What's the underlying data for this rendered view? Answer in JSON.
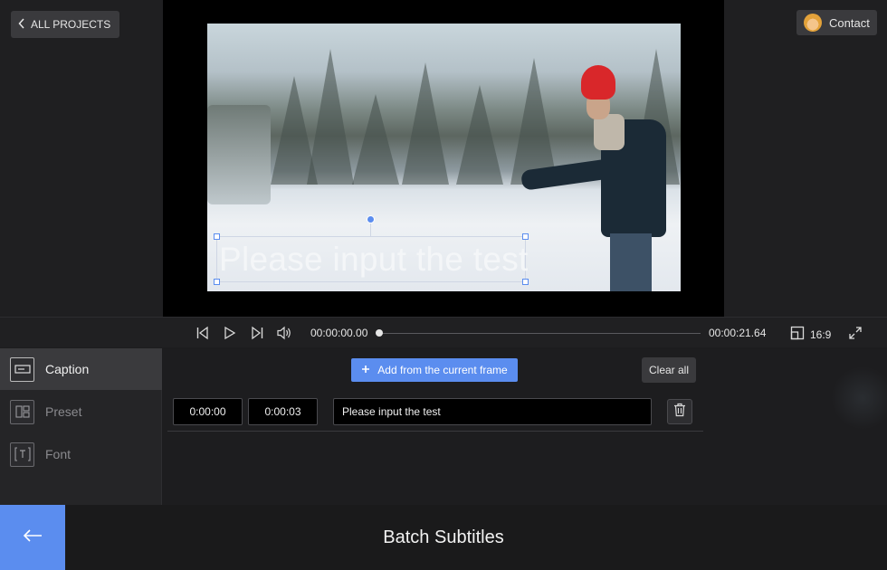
{
  "header": {
    "all_projects_label": "ALL PROJECTS",
    "contact_label": "Contact"
  },
  "preview": {
    "caption_text": "Please input the test"
  },
  "transport": {
    "current_time": "00:00:00.00",
    "total_time": "00:00:21.64",
    "aspect_ratio": "16:9",
    "progress": 0
  },
  "sidebar": {
    "items": [
      {
        "label": "Caption",
        "icon": "caption-icon",
        "active": true
      },
      {
        "label": "Preset",
        "icon": "preset-icon",
        "active": false
      },
      {
        "label": "Font",
        "icon": "font-icon",
        "active": false
      }
    ]
  },
  "editor": {
    "add_label": "Add from the current frame",
    "clear_label": "Clear all",
    "rows": [
      {
        "start": "0:00:00",
        "end": "0:00:03",
        "text": "Please input the test"
      }
    ]
  },
  "footer": {
    "title": "Batch Subtitles"
  },
  "colors": {
    "accent": "#5b8def",
    "hat": "#d9272a"
  }
}
